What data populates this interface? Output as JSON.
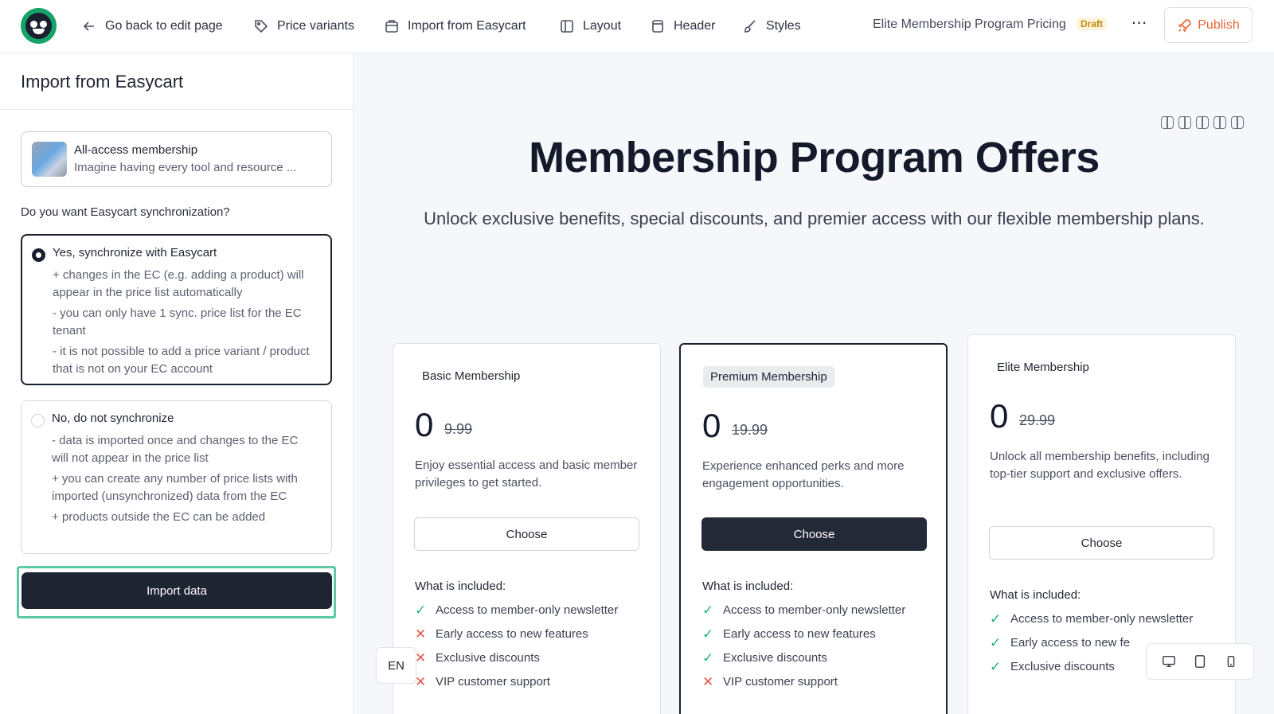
{
  "topbar": {
    "back_label": "Go back to edit page",
    "price_variants_label": "Price variants",
    "import_label": "Import from Easycart",
    "layout_label": "Layout",
    "header_label": "Header",
    "styles_label": "Styles",
    "doc_title": "Elite Membership Program Pricing",
    "status_badge": "Draft",
    "more_label": "⋯",
    "publish_label": "Publish"
  },
  "sidebar": {
    "title": "Import from Easycart",
    "product": {
      "name": "All-access membership",
      "description": "Imagine having every tool and resource ..."
    },
    "question": "Do you want Easycart synchronization?",
    "options": [
      {
        "title": "Yes, synchronize with Easycart",
        "selected": true,
        "lines": [
          "+ changes in the EC (e.g. adding a product) will appear in the price list automatically",
          "- you can only have 1 sync. price list for the EC tenant",
          "- it is not possible to add a price variant / product that is not on your EC account"
        ]
      },
      {
        "title": "No, do not synchronize",
        "selected": false,
        "lines": [
          "- data is imported once and changes to the EC will not appear in the price list",
          "+ you can create any number of price lists with imported (unsynchronized) data from the EC",
          "+ products outside the EC can be added"
        ]
      }
    ],
    "import_button": "Import data"
  },
  "canvas": {
    "heading": "Membership Program Offers",
    "subheading": "Unlock exclusive benefits, special discounts, and premier access with our flexible membership plans.",
    "plans": [
      {
        "name": "Basic Membership",
        "price": "0",
        "old_price": "9.99",
        "description": "Enjoy essential access and basic member privileges to get started.",
        "button": "Choose",
        "included_title": "What is included:",
        "features": [
          {
            "label": "Access to member-only newsletter",
            "included": true
          },
          {
            "label": "Early access to new features",
            "included": false
          },
          {
            "label": "Exclusive discounts",
            "included": false
          },
          {
            "label": "VIP customer support",
            "included": false
          }
        ]
      },
      {
        "name": "Premium Membership",
        "price": "0",
        "old_price": "19.99",
        "description": "Experience enhanced perks and more engagement opportunities.",
        "button": "Choose",
        "included_title": "What is included:",
        "features": [
          {
            "label": "Access to member-only newsletter",
            "included": true
          },
          {
            "label": "Early access to new features",
            "included": true
          },
          {
            "label": "Exclusive discounts",
            "included": true
          },
          {
            "label": "VIP customer support",
            "included": false
          }
        ]
      },
      {
        "name": "Elite Membership",
        "price": "0",
        "old_price": "29.99",
        "description": "Unlock all membership benefits, including top-tier support and exclusive offers.",
        "button": "Choose",
        "included_title": "What is included:",
        "features": [
          {
            "label": "Access to member-only newsletter",
            "included": true
          },
          {
            "label": "Early access to new fe",
            "included": true
          },
          {
            "label": "Exclusive discounts",
            "included": true
          }
        ]
      }
    ],
    "language": "EN"
  },
  "colors": {
    "accent": "#1f2433",
    "highlight": "#5ec9a6",
    "publish": "#e8663a",
    "check": "#22b573",
    "cross": "#e05a4f"
  }
}
